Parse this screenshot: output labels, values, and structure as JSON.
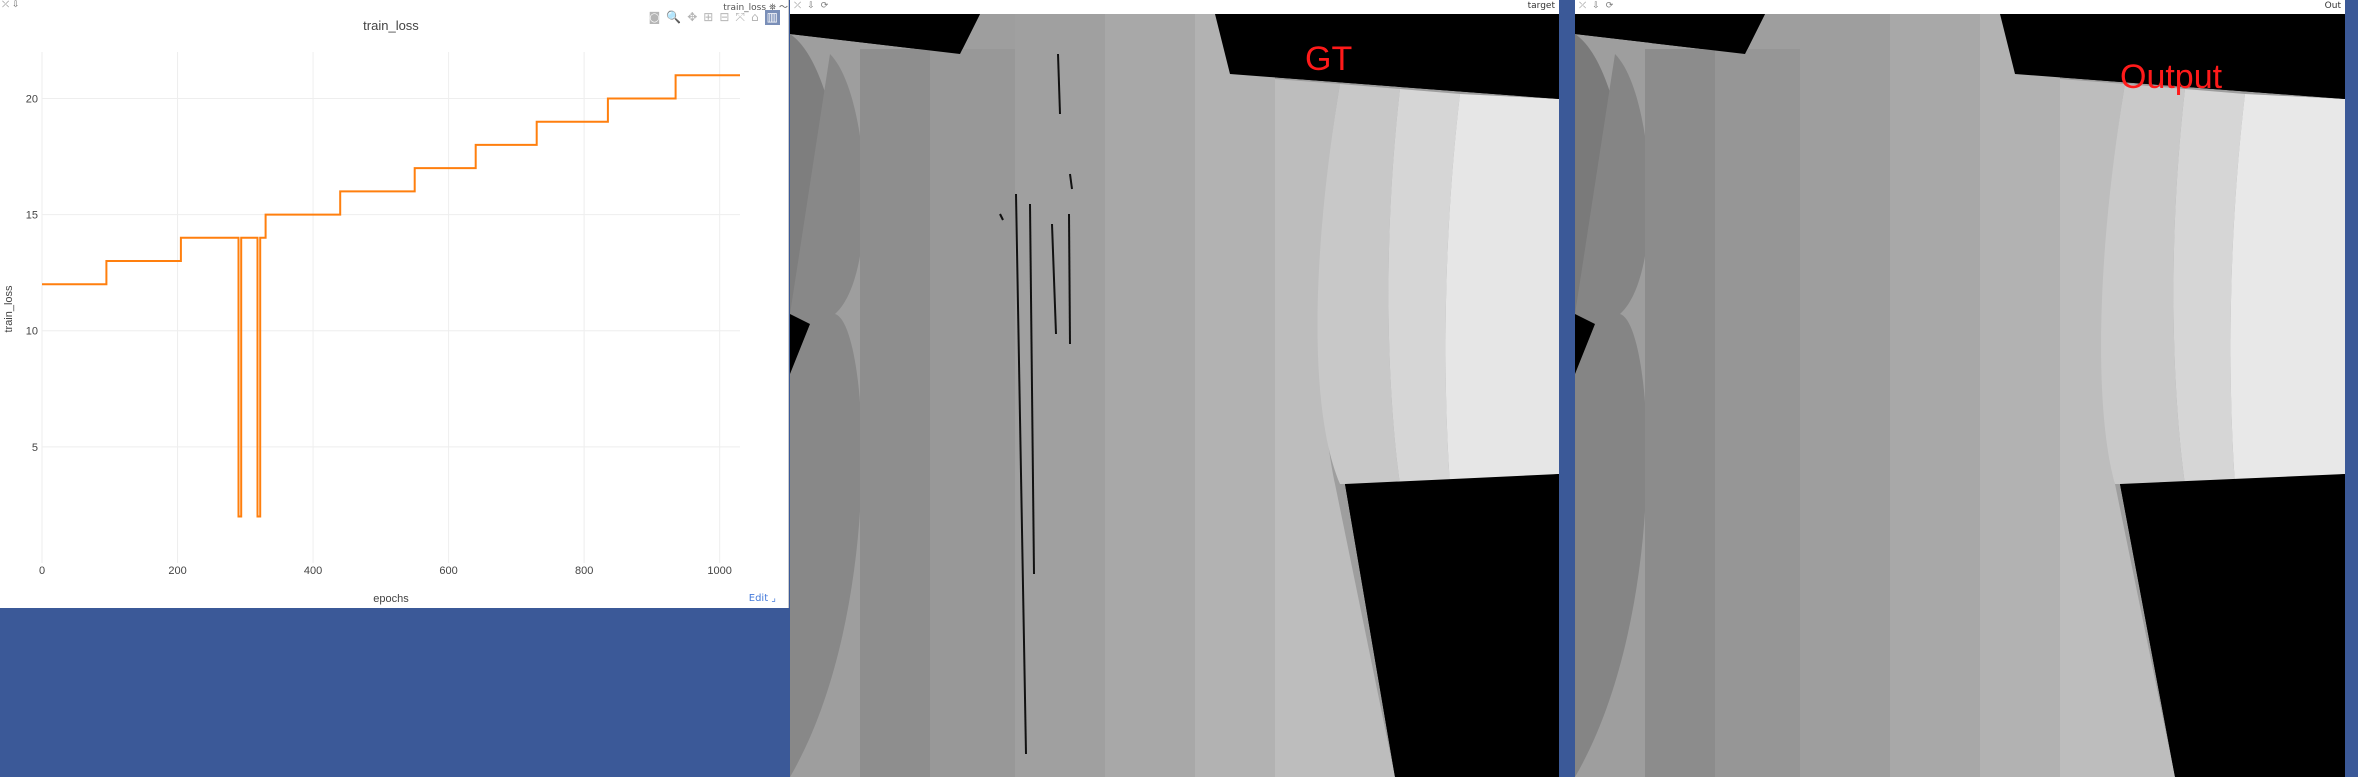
{
  "plot_window": {
    "window_controls": "⤫ ⇩",
    "legend_label": "train_loss",
    "edit_label": "Edit",
    "modebar_icons": [
      "camera-icon",
      "zoom-icon",
      "pan-icon",
      "zoom-in-icon",
      "zoom-out-icon",
      "autoscale-icon",
      "reset-axes-icon",
      "spike-icon"
    ]
  },
  "chart_data": {
    "type": "line",
    "title": "train_loss",
    "xlabel": "epochs",
    "ylabel": "train_loss",
    "xlim": [
      0,
      1030
    ],
    "ylim": [
      0,
      22
    ],
    "x_ticks": [
      0,
      200,
      400,
      600,
      800,
      1000
    ],
    "y_ticks": [
      5,
      10,
      15,
      20
    ],
    "grid": true,
    "line_color": "#ff7f0e",
    "series": [
      {
        "name": "train_loss",
        "points": [
          [
            0,
            12
          ],
          [
            95,
            12
          ],
          [
            95,
            13
          ],
          [
            205,
            13
          ],
          [
            205,
            14
          ],
          [
            290,
            14
          ],
          [
            290,
            2
          ],
          [
            294,
            2
          ],
          [
            294,
            14
          ],
          [
            318,
            14
          ],
          [
            318,
            2
          ],
          [
            322,
            2
          ],
          [
            322,
            14
          ],
          [
            330,
            14
          ],
          [
            330,
            15
          ],
          [
            440,
            15
          ],
          [
            440,
            16
          ],
          [
            550,
            16
          ],
          [
            550,
            17
          ],
          [
            640,
            17
          ],
          [
            640,
            18
          ],
          [
            730,
            18
          ],
          [
            730,
            19
          ],
          [
            835,
            19
          ],
          [
            835,
            20
          ],
          [
            935,
            20
          ],
          [
            935,
            21
          ],
          [
            1030,
            21
          ]
        ]
      }
    ]
  },
  "gt_window": {
    "header_title": "target",
    "overlay_label": "GT"
  },
  "out_window": {
    "header_title": "Out",
    "overlay_label": "Output"
  },
  "colors": {
    "background": "#3b5998",
    "line": "#ff7f0e",
    "label_red": "#ff1a1a"
  }
}
